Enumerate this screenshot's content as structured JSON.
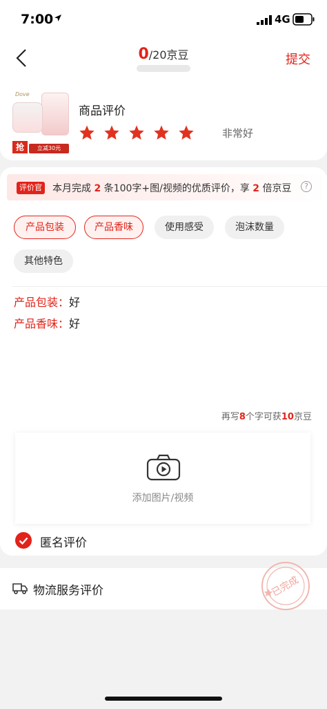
{
  "status_bar": {
    "time": "7:00",
    "network": "4G"
  },
  "nav": {
    "count_current": "0",
    "count_total": "/20京豆",
    "submit_label": "提交"
  },
  "product": {
    "brand": "Dove",
    "grab_label": "抢",
    "coupon_label": "立减30元",
    "title": "商品评价",
    "rating": 5,
    "rating_text": "非常好"
  },
  "banner": {
    "badge": "评价官",
    "text_1": "本月完成",
    "num_1": "2",
    "text_2": "条100字+图/视频的优质评价，享",
    "num_2": "2",
    "text_3": "倍京豆",
    "help": "?"
  },
  "tags": [
    {
      "label": "产品包装",
      "selected": true
    },
    {
      "label": "产品香味",
      "selected": true
    },
    {
      "label": "使用感受",
      "selected": false
    },
    {
      "label": "泡沫数量",
      "selected": false
    },
    {
      "label": "其他特色",
      "selected": false
    }
  ],
  "review_lines": [
    {
      "key": "产品包装：",
      "value": "好"
    },
    {
      "key": "产品香味：",
      "value": "好"
    }
  ],
  "counter": {
    "t1": "再写",
    "n1": "8",
    "t2": "个字可获",
    "n2": "10",
    "t3": "京豆"
  },
  "upload": {
    "label": "添加图片/视频"
  },
  "anonymous": {
    "label": "匿名评价",
    "checked": true
  },
  "logistics": {
    "label": "物流服务评价",
    "stamp": "已完成"
  },
  "colors": {
    "accent": "#e2231a",
    "tag_bg": "#fff1ef"
  }
}
